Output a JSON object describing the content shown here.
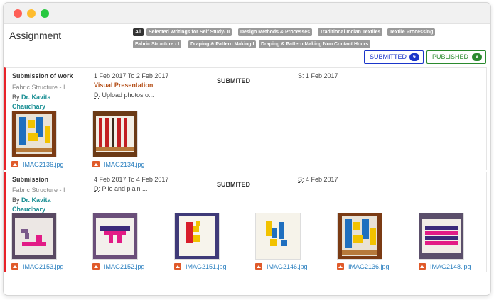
{
  "page": {
    "title": "Assignment"
  },
  "filters": {
    "tags": [
      "All",
      "Selected Writings for Self Study- II",
      "Design Methods & Processes",
      "Traditional Indian Textiles",
      "Textile Processing",
      "Fabric Structure - I",
      "Draping & Pattern Making I",
      "Draping & Pattern Making Non Contact Hours"
    ],
    "active": "All"
  },
  "counts": {
    "submitted_label": "SUBMITTED",
    "submitted_count": "6",
    "published_label": "PUBLISHED",
    "published_count": "9"
  },
  "colors": {
    "accent_red": "#e8232a",
    "submitted_blue": "#1a35c9",
    "published_green": "#2a8a2e",
    "link_blue": "#2a7fbf",
    "teal": "#1a8f94"
  },
  "icons": {
    "file": "image-file-icon"
  },
  "submissions": [
    {
      "title": "Submission of work",
      "subject": "Fabric Structure - I",
      "by_prefix": "By",
      "author": "Dr. Kavita Chaudhary",
      "date_range": "1 Feb 2017 To 2 Feb 2017",
      "category": "Visual Presentation",
      "desc_prefix": "D:",
      "desc": " Upload photos o...",
      "status": "SUBMITED",
      "s_prefix": "S:",
      "s_date": " 1 Feb 2017",
      "files": [
        "IMAG2136.jpg",
        "IMAG2134.jpg"
      ]
    },
    {
      "title": "Submission",
      "subject": "Fabric Structure - I",
      "by_prefix": "By",
      "author": "Dr. Kavita Chaudhary",
      "date_range": "4 Feb 2017 To 4 Feb 2017",
      "category": "",
      "desc_prefix": "D:",
      "desc": " Pile and plain ...",
      "status": "SUBMITED",
      "s_prefix": "S:",
      "s_date": " 4 Feb 2017",
      "files": [
        "IMAG2153.jpg",
        "IMAG2152.jpg",
        "IMAG2151.jpg",
        "IMAG2146.jpg",
        "IMAG2136.jpg",
        "IMAG2148.jpg"
      ]
    }
  ]
}
